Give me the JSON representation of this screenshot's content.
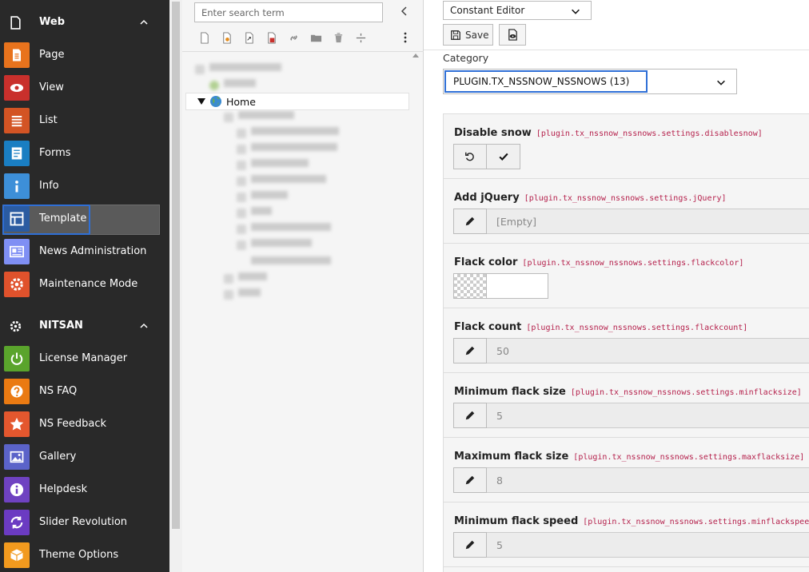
{
  "colors": {
    "sidebar_bg": "#292929",
    "active_outline": "#2f6fd6",
    "key_text": "#b5214c"
  },
  "sidebar": {
    "sections": [
      {
        "label": "Web",
        "icon": "file-icon"
      },
      {
        "label": "NITSAN",
        "icon": "gear-icon"
      }
    ],
    "web_items": [
      {
        "label": "Page",
        "icon": "page-icon",
        "color": "#e8731d"
      },
      {
        "label": "View",
        "icon": "eye-icon",
        "color": "#c9302c"
      },
      {
        "label": "List",
        "icon": "list-icon",
        "color": "#d35424"
      },
      {
        "label": "Forms",
        "icon": "forms-icon",
        "color": "#1a7ec2"
      },
      {
        "label": "Info",
        "icon": "info-icon",
        "color": "#3d8fd8"
      },
      {
        "label": "Template",
        "icon": "template-icon",
        "color": "#2b5ba1",
        "active": true
      },
      {
        "label": "News Administration",
        "icon": "news-icon",
        "color": "#7f8ff4"
      },
      {
        "label": "Maintenance Mode",
        "icon": "maintenance-icon",
        "color": "#e0522c"
      }
    ],
    "nitsan_items": [
      {
        "label": "License Manager",
        "icon": "power-icon",
        "color": "#5aa42c"
      },
      {
        "label": "NS FAQ",
        "icon": "faq-icon",
        "color": "#ea7a12"
      },
      {
        "label": "NS Feedback",
        "icon": "star-icon",
        "color": "#e4572e"
      },
      {
        "label": "Gallery",
        "icon": "gallery-icon",
        "color": "#5b63c9"
      },
      {
        "label": "Helpdesk",
        "icon": "helpdesk-icon",
        "color": "#6f42c1"
      },
      {
        "label": "Slider Revolution",
        "icon": "sync-icon",
        "color": "#6b3bc2"
      },
      {
        "label": "Theme Options",
        "icon": "box-icon",
        "color": "#f29a1e"
      }
    ]
  },
  "tree": {
    "search_placeholder": "Enter search term",
    "home_label": "Home"
  },
  "main": {
    "module_select": "Constant Editor",
    "save_label": "Save",
    "category_label": "Category",
    "category_value": "PLUGIN.TX_NSSNOW_NSSNOWS (13)",
    "rows": [
      {
        "label": "Disable snow",
        "key": "[plugin.tx_nssnow_nssnows.settings.disablesnow]",
        "kind": "checkbox"
      },
      {
        "label": "Add jQuery",
        "key": "[plugin.tx_nssnow_nssnows.settings.jQuery]",
        "kind": "text",
        "value": "[Empty]"
      },
      {
        "label": "Flack color",
        "key": "[plugin.tx_nssnow_nssnows.settings.flackcolor]",
        "kind": "color",
        "value": ""
      },
      {
        "label": "Flack count",
        "key": "[plugin.tx_nssnow_nssnows.settings.flackcount]",
        "kind": "text",
        "value": "50"
      },
      {
        "label": "Minimum flack size",
        "key": "[plugin.tx_nssnow_nssnows.settings.minflacksize]",
        "kind": "text",
        "value": "5"
      },
      {
        "label": "Maximum flack size",
        "key": "[plugin.tx_nssnow_nssnows.settings.maxflacksize]",
        "kind": "text",
        "value": "8"
      },
      {
        "label": "Minimum flack speed",
        "key": "[plugin.tx_nssnow_nssnows.settings.minflackspeed]",
        "kind": "text",
        "value": "5"
      }
    ]
  }
}
